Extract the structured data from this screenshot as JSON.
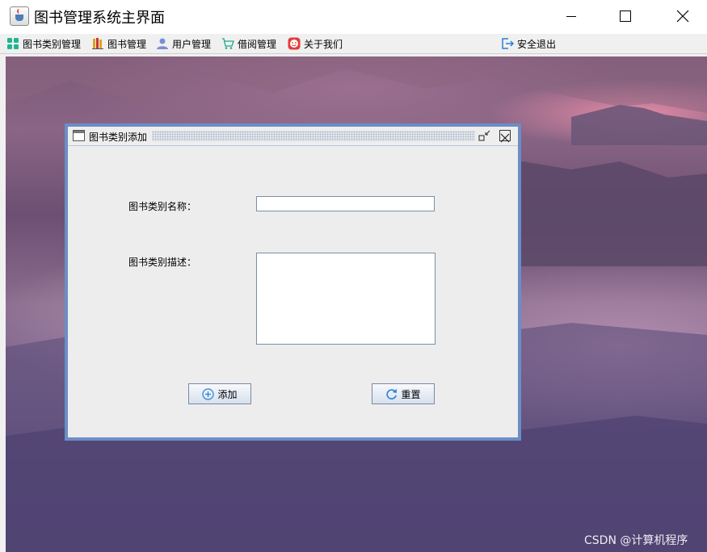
{
  "window": {
    "title": "图书管理系统主界面"
  },
  "menubar": {
    "items": [
      {
        "label": "图书类别管理",
        "icon": "grid-icon"
      },
      {
        "label": "图书管理",
        "icon": "books-icon"
      },
      {
        "label": "用户管理",
        "icon": "user-icon"
      },
      {
        "label": "借阅管理",
        "icon": "cart-icon"
      },
      {
        "label": "关于我们",
        "icon": "smiley-icon"
      }
    ],
    "logout": {
      "label": "安全退出",
      "icon": "logout-icon"
    }
  },
  "dialog": {
    "title": "图书类别添加",
    "name_label": "图书类别名称：",
    "name_value": "",
    "desc_label": "图书类别描述：",
    "desc_value": "",
    "add_button": "添加",
    "reset_button": "重置"
  },
  "watermark": "CSDN @计算机程序",
  "colors": {
    "frame_border": "#6b8ec6",
    "panel_bg": "#ededed",
    "button_icon": "#2a7fd4"
  }
}
